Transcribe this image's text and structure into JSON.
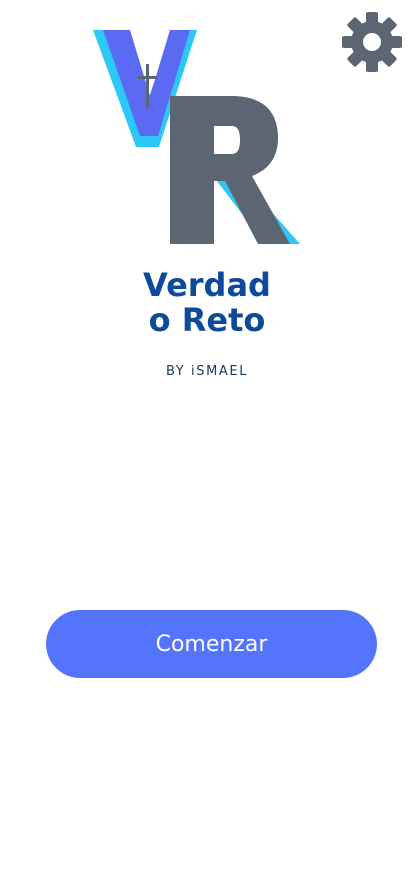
{
  "app": {
    "title_line1": "Verdad",
    "title_line2": "o Reto",
    "subtitle": "BY iSMAEL"
  },
  "logo": {
    "letters": [
      "V",
      "R"
    ]
  },
  "actions": {
    "start_label": "Comenzar"
  },
  "icons": {
    "settings": "gear-icon",
    "logo": "vr-logo-icon"
  },
  "colors": {
    "title": "#0e4a9c",
    "button": "#5474fc",
    "gear": "#5c6673",
    "logo_v_front": "#5a6af2",
    "logo_v_shadow": "#2ec8f8",
    "logo_r": "#5c6673"
  }
}
